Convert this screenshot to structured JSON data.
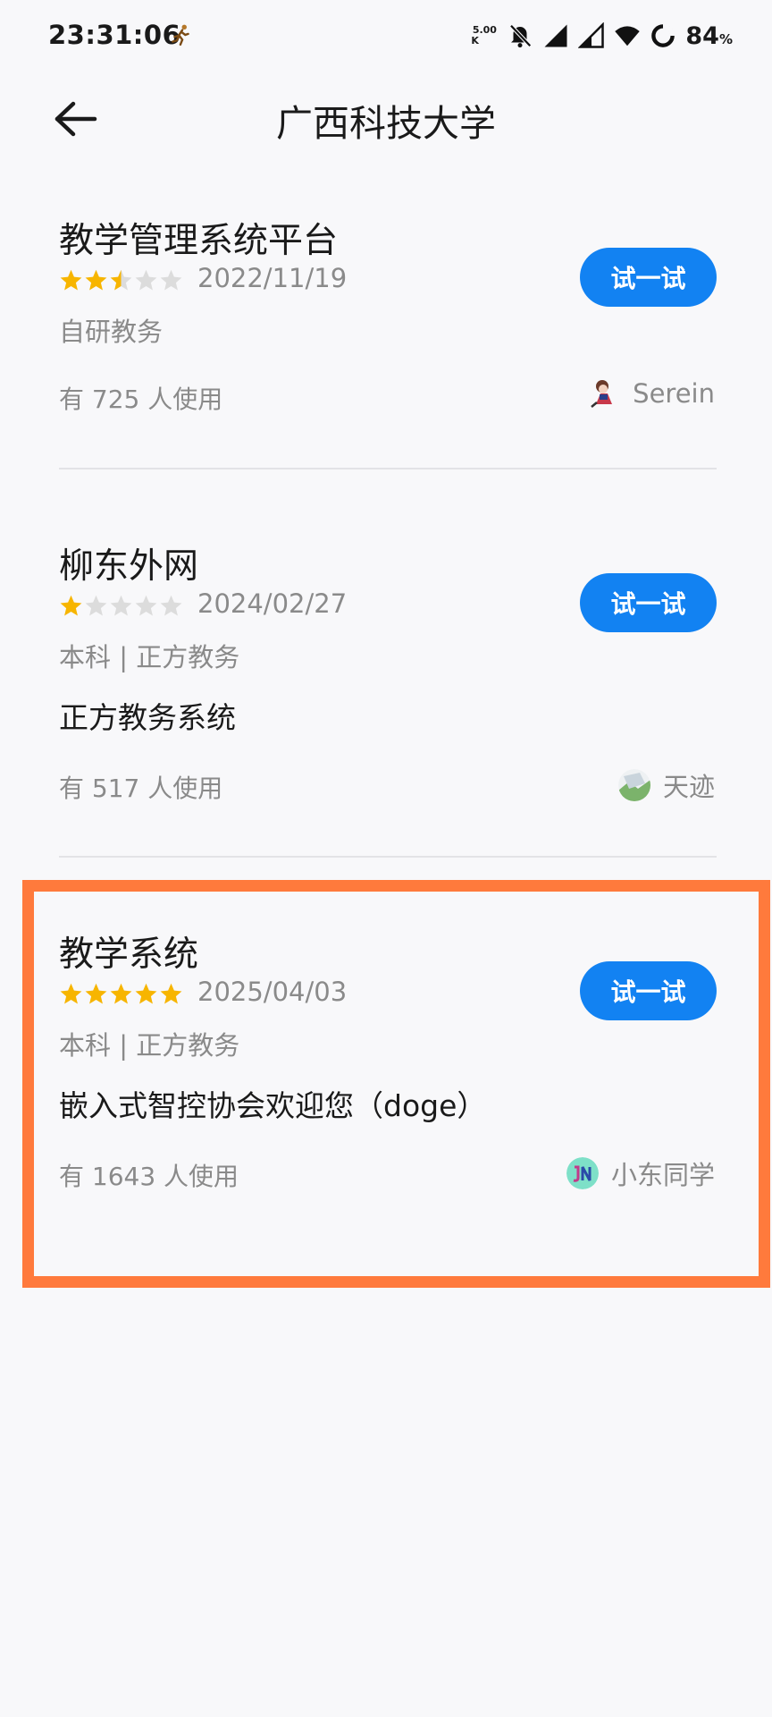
{
  "status_bar": {
    "time": "23:31:06",
    "net_speed_value": "5.00",
    "net_speed_unit": "K",
    "battery_percent": "84",
    "battery_unit": "%",
    "icons": [
      "running-man-icon",
      "mute-bell-icon",
      "signal-icon",
      "signal-weak-icon",
      "wifi-icon",
      "battery-ring-icon"
    ]
  },
  "header": {
    "title": "广西科技大学",
    "back_icon": "arrow-left-icon"
  },
  "button_label": "试一试",
  "items": [
    {
      "title": "教学管理系统平台",
      "rating": 2.5,
      "rating_max": 5,
      "date": "2022/11/19",
      "tags": "自研教务",
      "description": "",
      "users": "有 725 人使用",
      "author": "Serein"
    },
    {
      "title": "柳东外网",
      "rating": 1,
      "rating_max": 5,
      "date": "2024/02/27",
      "tags": "本科 | 正方教务",
      "description": "正方教务系统",
      "users": "有 517 人使用",
      "author": "天迹"
    },
    {
      "title": "教学系统",
      "rating": 5,
      "rating_max": 5,
      "date": "2025/04/03",
      "tags": "本科 | 正方教务",
      "description": "嵌入式智控协会欢迎您（doge）",
      "users": "有 1643 人使用",
      "author": "小东同学"
    }
  ],
  "colors": {
    "accent": "#1282f2",
    "star_filled": "#f7b500",
    "star_empty": "#dcdcdc",
    "highlight": "#ff7a3c",
    "background": "#f8f8fa"
  }
}
